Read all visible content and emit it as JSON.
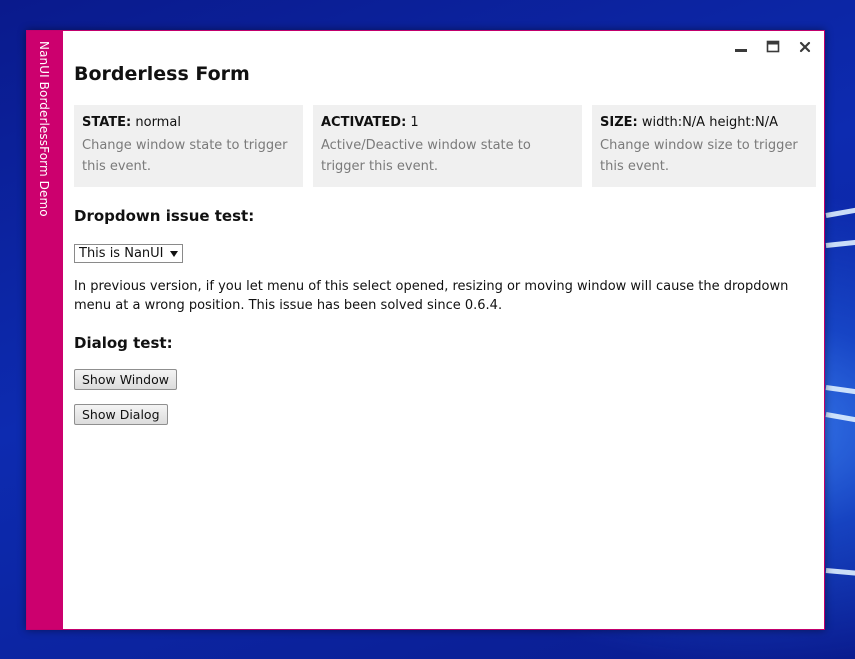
{
  "window": {
    "sidebar_title": "NanUI BorderlessForm Demo",
    "accent_color": "#cc006e"
  },
  "controls": {
    "minimize_icon": "minimize-icon",
    "maximize_icon": "maximize-icon",
    "close_icon": "close-icon"
  },
  "page_title": "Borderless Form",
  "cards": [
    {
      "label": "STATE:",
      "value": "normal",
      "description": "Change window state to trigger this event."
    },
    {
      "label": "ACTIVATED:",
      "value": "1",
      "description": "Active/Deactive window state to trigger this event."
    },
    {
      "label": "SIZE:",
      "value": "width:N/A height:N/A",
      "description": "Change window size to trigger this event."
    }
  ],
  "dropdown_section": {
    "title": "Dropdown issue test:",
    "select_value": "This is NanUI",
    "description": "In previous version, if you let menu of this select opened, resizing or moving window will cause the dropdown menu at a wrong position. This issue has been solved since 0.6.4."
  },
  "dialog_section": {
    "title": "Dialog test:",
    "show_window_label": "Show Window",
    "show_dialog_label": "Show Dialog"
  }
}
